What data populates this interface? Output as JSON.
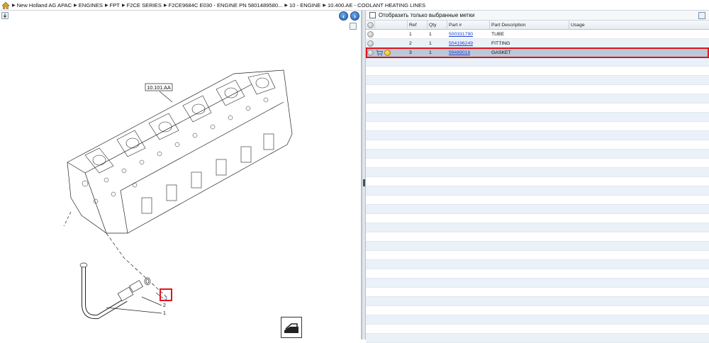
{
  "breadcrumb": {
    "items": [
      "New Holland AG APAC",
      "ENGINES",
      "FPT",
      "F2CE SERIES",
      "F2CE9684C E030 - ENGINE PN 5801489580...",
      "10 - ENGINE",
      "10.400.AE - COOLANT HEATING LINES"
    ]
  },
  "drawing": {
    "section_label": "10.101.AA",
    "callouts": [
      "3",
      "2",
      "1"
    ]
  },
  "filter": {
    "label": "Отобразить только выбранные метки"
  },
  "grid": {
    "columns": [
      "Ref",
      "Qty",
      "Part #",
      "Part Description",
      "Usage"
    ],
    "rows": [
      {
        "ref": "1",
        "qty": "1",
        "part": "500331790",
        "desc": "TUBE",
        "usage": ""
      },
      {
        "ref": "2",
        "qty": "1",
        "part": "504196249",
        "desc": "FITTING",
        "usage": ""
      },
      {
        "ref": "3",
        "qty": "1",
        "part": "99489016",
        "desc": "GASKET",
        "usage": ""
      }
    ],
    "selected_row": 3
  },
  "colors": {
    "highlight": "#e0141e",
    "link": "#1a3fd6",
    "selected_row": "#b9c9d8",
    "alt_row": "#eaf1f9"
  },
  "icons": [
    "home-icon",
    "arrow-right-icon",
    "nav-back-icon",
    "nav-forward-icon",
    "cart-icon",
    "info-icon",
    "print-icon"
  ]
}
